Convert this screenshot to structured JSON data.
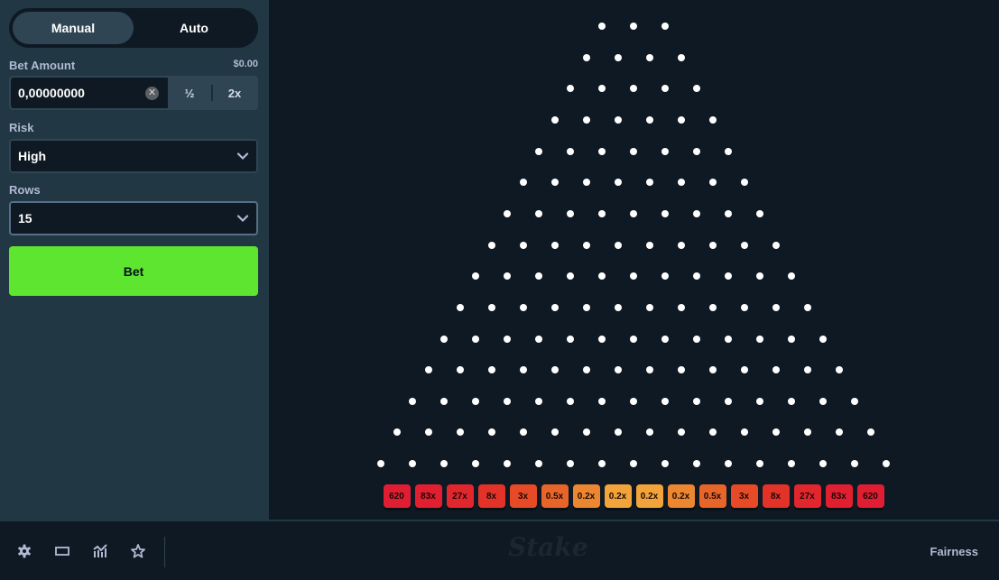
{
  "sidebar": {
    "mode_tabs": [
      {
        "label": "Manual",
        "active": true
      },
      {
        "label": "Auto",
        "active": false
      }
    ],
    "bet_amount": {
      "label": "Bet Amount",
      "usd_value": "$0.00",
      "value": "0,00000000",
      "half_label": "½",
      "double_label": "2x",
      "clear_icon": "close-circle-icon"
    },
    "risk": {
      "label": "Risk",
      "selected": "High"
    },
    "rows": {
      "label": "Rows",
      "selected": "15"
    },
    "bet_button_label": "Bet"
  },
  "game": {
    "name": "Plinko",
    "peg_rows": 15,
    "top_row_pegs": 3,
    "buckets": [
      {
        "label": "620",
        "color": "#e01e33"
      },
      {
        "label": "83x",
        "color": "#e11f31"
      },
      {
        "label": "27x",
        "color": "#e2262d"
      },
      {
        "label": "8x",
        "color": "#e33228"
      },
      {
        "label": "3x",
        "color": "#e64a27"
      },
      {
        "label": "0.5x",
        "color": "#e8652a"
      },
      {
        "label": "0.2x",
        "color": "#ec8631"
      },
      {
        "label": "0.2x",
        "color": "#f2a33a"
      },
      {
        "label": "0.2x",
        "color": "#f2a33a"
      },
      {
        "label": "0.2x",
        "color": "#ec8631"
      },
      {
        "label": "0.5x",
        "color": "#e8652a"
      },
      {
        "label": "3x",
        "color": "#e64a27"
      },
      {
        "label": "8x",
        "color": "#e33228"
      },
      {
        "label": "27x",
        "color": "#e2262d"
      },
      {
        "label": "83x",
        "color": "#e11f31"
      },
      {
        "label": "620",
        "color": "#e01e33"
      }
    ]
  },
  "footer": {
    "icons": [
      "settings-icon",
      "theatre-mode-icon",
      "live-stats-icon",
      "favorite-star-icon"
    ],
    "logo_text": "Stake",
    "fairness_label": "Fairness"
  }
}
